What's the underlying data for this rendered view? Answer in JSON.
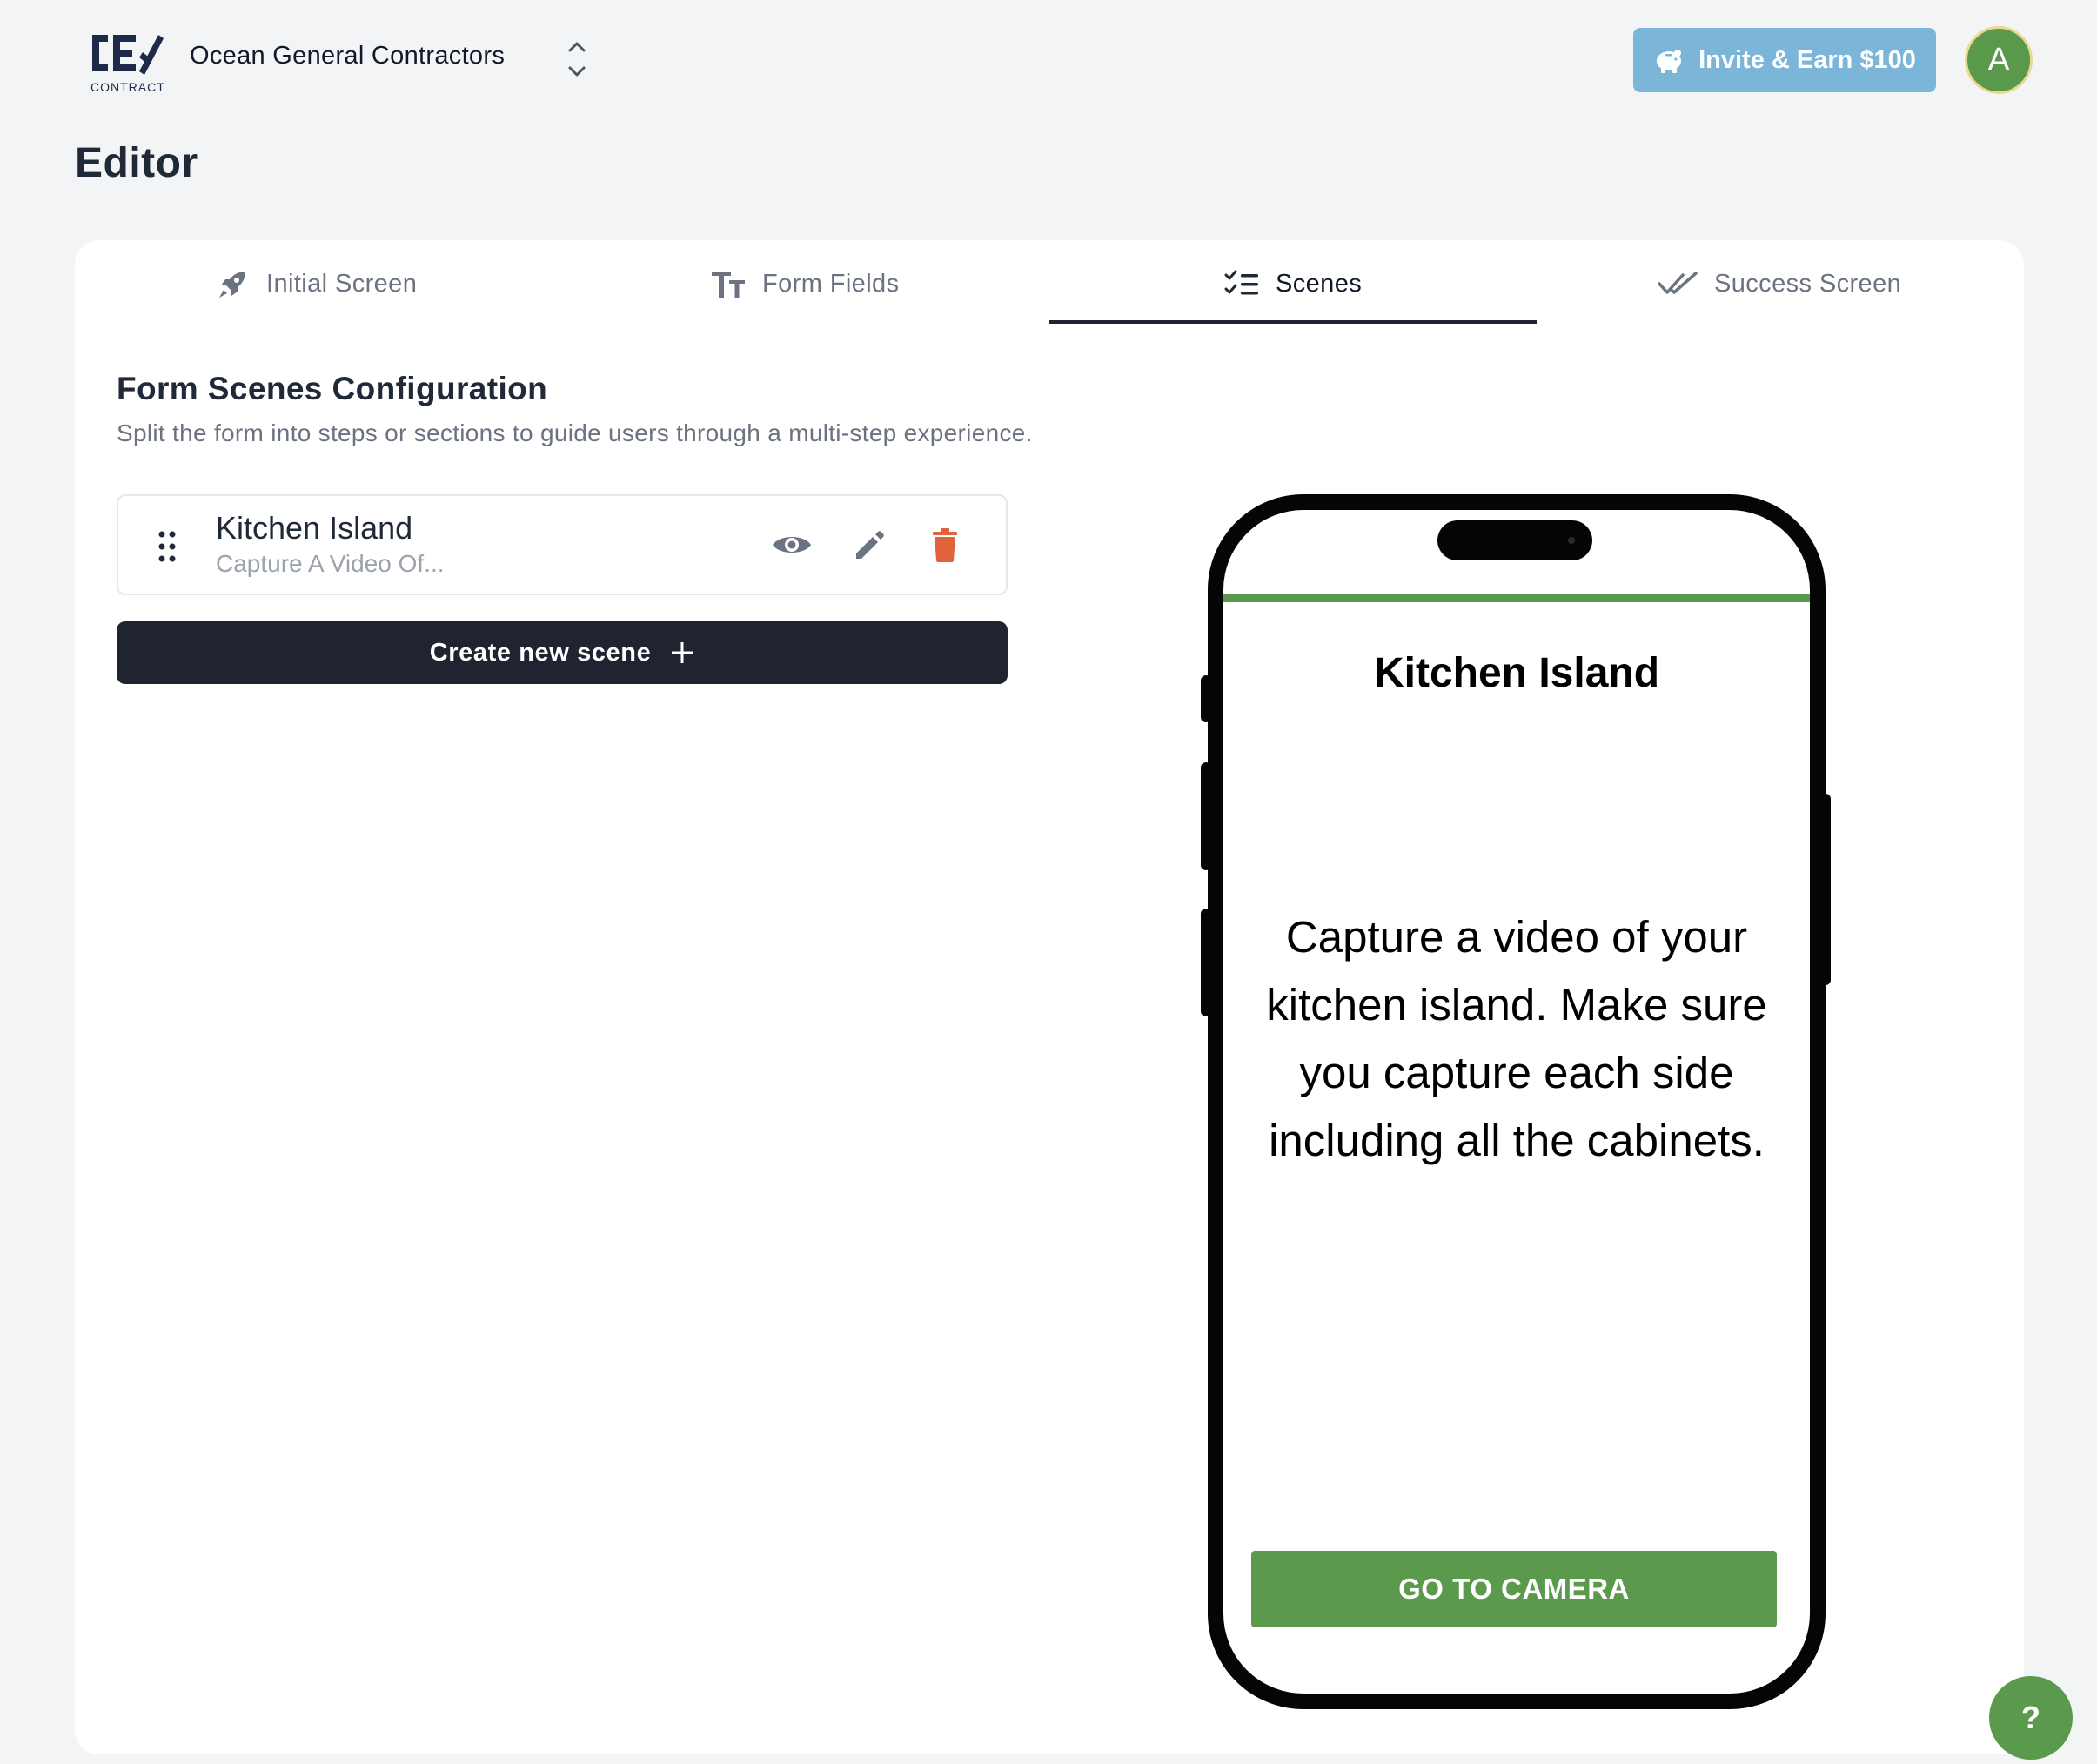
{
  "header": {
    "logo_text": "CONTRACT",
    "company_name": "Ocean General Contractors",
    "invite_label": "Invite & Earn $100",
    "avatar_initial": "A"
  },
  "page": {
    "title": "Editor"
  },
  "tabs": [
    {
      "label": "Initial Screen",
      "icon": "rocket-icon",
      "active": false
    },
    {
      "label": "Form Fields",
      "icon": "text-size-icon",
      "active": false
    },
    {
      "label": "Scenes",
      "icon": "checklist-icon",
      "active": true
    },
    {
      "label": "Success Screen",
      "icon": "double-check-icon",
      "active": false
    }
  ],
  "section": {
    "title": "Form Scenes Configuration",
    "description": "Split the form into steps or sections to guide users through a multi-step experience."
  },
  "scenes": [
    {
      "name": "Kitchen Island",
      "subtitle": "Capture A Video Of..."
    }
  ],
  "create_button": {
    "label": "Create new scene"
  },
  "preview": {
    "title": "Kitchen Island",
    "body": "Capture a video of your kitchen island. Make sure you capture each side including all the cabinets.",
    "button": "GO TO CAMERA"
  },
  "help": {
    "label": "?"
  },
  "colors": {
    "accent_green": "#5b9a4d",
    "invite_blue": "#7bb6d9",
    "dark_button": "#1f2430",
    "delete_red": "#e0633c"
  }
}
